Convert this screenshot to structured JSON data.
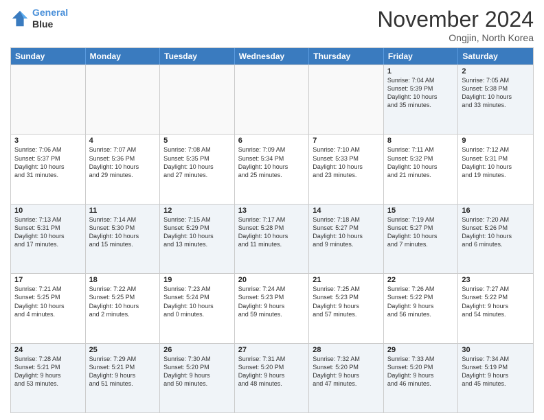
{
  "header": {
    "logo_line1": "General",
    "logo_line2": "Blue",
    "month": "November 2024",
    "location": "Ongjin, North Korea"
  },
  "weekdays": [
    "Sunday",
    "Monday",
    "Tuesday",
    "Wednesday",
    "Thursday",
    "Friday",
    "Saturday"
  ],
  "rows": [
    [
      {
        "day": "",
        "info": ""
      },
      {
        "day": "",
        "info": ""
      },
      {
        "day": "",
        "info": ""
      },
      {
        "day": "",
        "info": ""
      },
      {
        "day": "",
        "info": ""
      },
      {
        "day": "1",
        "info": "Sunrise: 7:04 AM\nSunset: 5:39 PM\nDaylight: 10 hours\nand 35 minutes."
      },
      {
        "day": "2",
        "info": "Sunrise: 7:05 AM\nSunset: 5:38 PM\nDaylight: 10 hours\nand 33 minutes."
      }
    ],
    [
      {
        "day": "3",
        "info": "Sunrise: 7:06 AM\nSunset: 5:37 PM\nDaylight: 10 hours\nand 31 minutes."
      },
      {
        "day": "4",
        "info": "Sunrise: 7:07 AM\nSunset: 5:36 PM\nDaylight: 10 hours\nand 29 minutes."
      },
      {
        "day": "5",
        "info": "Sunrise: 7:08 AM\nSunset: 5:35 PM\nDaylight: 10 hours\nand 27 minutes."
      },
      {
        "day": "6",
        "info": "Sunrise: 7:09 AM\nSunset: 5:34 PM\nDaylight: 10 hours\nand 25 minutes."
      },
      {
        "day": "7",
        "info": "Sunrise: 7:10 AM\nSunset: 5:33 PM\nDaylight: 10 hours\nand 23 minutes."
      },
      {
        "day": "8",
        "info": "Sunrise: 7:11 AM\nSunset: 5:32 PM\nDaylight: 10 hours\nand 21 minutes."
      },
      {
        "day": "9",
        "info": "Sunrise: 7:12 AM\nSunset: 5:31 PM\nDaylight: 10 hours\nand 19 minutes."
      }
    ],
    [
      {
        "day": "10",
        "info": "Sunrise: 7:13 AM\nSunset: 5:31 PM\nDaylight: 10 hours\nand 17 minutes."
      },
      {
        "day": "11",
        "info": "Sunrise: 7:14 AM\nSunset: 5:30 PM\nDaylight: 10 hours\nand 15 minutes."
      },
      {
        "day": "12",
        "info": "Sunrise: 7:15 AM\nSunset: 5:29 PM\nDaylight: 10 hours\nand 13 minutes."
      },
      {
        "day": "13",
        "info": "Sunrise: 7:17 AM\nSunset: 5:28 PM\nDaylight: 10 hours\nand 11 minutes."
      },
      {
        "day": "14",
        "info": "Sunrise: 7:18 AM\nSunset: 5:27 PM\nDaylight: 10 hours\nand 9 minutes."
      },
      {
        "day": "15",
        "info": "Sunrise: 7:19 AM\nSunset: 5:27 PM\nDaylight: 10 hours\nand 7 minutes."
      },
      {
        "day": "16",
        "info": "Sunrise: 7:20 AM\nSunset: 5:26 PM\nDaylight: 10 hours\nand 6 minutes."
      }
    ],
    [
      {
        "day": "17",
        "info": "Sunrise: 7:21 AM\nSunset: 5:25 PM\nDaylight: 10 hours\nand 4 minutes."
      },
      {
        "day": "18",
        "info": "Sunrise: 7:22 AM\nSunset: 5:25 PM\nDaylight: 10 hours\nand 2 minutes."
      },
      {
        "day": "19",
        "info": "Sunrise: 7:23 AM\nSunset: 5:24 PM\nDaylight: 10 hours\nand 0 minutes."
      },
      {
        "day": "20",
        "info": "Sunrise: 7:24 AM\nSunset: 5:23 PM\nDaylight: 9 hours\nand 59 minutes."
      },
      {
        "day": "21",
        "info": "Sunrise: 7:25 AM\nSunset: 5:23 PM\nDaylight: 9 hours\nand 57 minutes."
      },
      {
        "day": "22",
        "info": "Sunrise: 7:26 AM\nSunset: 5:22 PM\nDaylight: 9 hours\nand 56 minutes."
      },
      {
        "day": "23",
        "info": "Sunrise: 7:27 AM\nSunset: 5:22 PM\nDaylight: 9 hours\nand 54 minutes."
      }
    ],
    [
      {
        "day": "24",
        "info": "Sunrise: 7:28 AM\nSunset: 5:21 PM\nDaylight: 9 hours\nand 53 minutes."
      },
      {
        "day": "25",
        "info": "Sunrise: 7:29 AM\nSunset: 5:21 PM\nDaylight: 9 hours\nand 51 minutes."
      },
      {
        "day": "26",
        "info": "Sunrise: 7:30 AM\nSunset: 5:20 PM\nDaylight: 9 hours\nand 50 minutes."
      },
      {
        "day": "27",
        "info": "Sunrise: 7:31 AM\nSunset: 5:20 PM\nDaylight: 9 hours\nand 48 minutes."
      },
      {
        "day": "28",
        "info": "Sunrise: 7:32 AM\nSunset: 5:20 PM\nDaylight: 9 hours\nand 47 minutes."
      },
      {
        "day": "29",
        "info": "Sunrise: 7:33 AM\nSunset: 5:20 PM\nDaylight: 9 hours\nand 46 minutes."
      },
      {
        "day": "30",
        "info": "Sunrise: 7:34 AM\nSunset: 5:19 PM\nDaylight: 9 hours\nand 45 minutes."
      }
    ]
  ]
}
